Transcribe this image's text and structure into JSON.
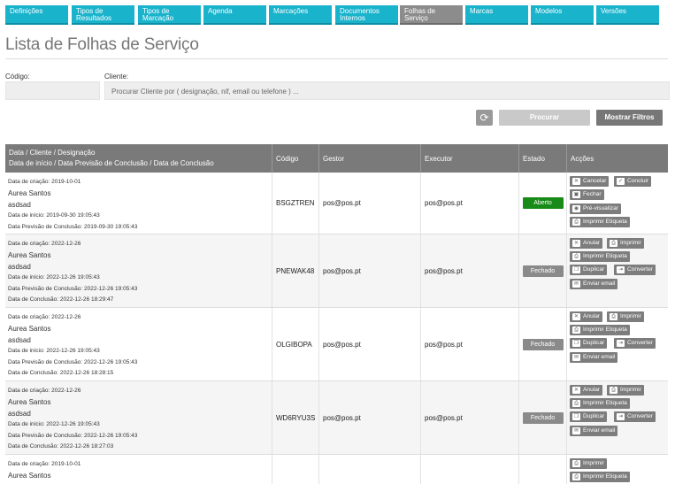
{
  "nav": {
    "tabs": [
      {
        "label": "Definições",
        "active": false
      },
      {
        "label": "Tipos de Resultados",
        "active": false
      },
      {
        "label": "Tipos de Marcação",
        "active": false
      },
      {
        "label": "Agenda",
        "active": false
      },
      {
        "label": "Marcações",
        "active": false
      },
      {
        "label": "Documentos Internos",
        "active": false
      },
      {
        "label": "Folhas de Serviço",
        "active": true
      },
      {
        "label": "Marcas",
        "active": false
      },
      {
        "label": "Modelos",
        "active": false
      },
      {
        "label": "Versões",
        "active": false
      }
    ]
  },
  "page_title": "Lista de Folhas de Serviço",
  "filters": {
    "codigo_label": "Código:",
    "codigo_value": "",
    "cliente_label": "Cliente:",
    "cliente_placeholder": "Procurar Cliente por ( designação, nif, email ou telefone ) ..."
  },
  "buttons": {
    "procurar": "Procurar",
    "mostrar_filtros": "Mostrar Filtros",
    "refresh_icon": "refresh-icon"
  },
  "table": {
    "headers": {
      "main_line1": "Data / Cliente / Designação",
      "main_line2": "Data de início / Data Previsão de Conclusão / Data de Conclusão",
      "codigo": "Código",
      "gestor": "Gestor",
      "executor": "Executor",
      "estado": "Estado",
      "accoes": "Acções"
    },
    "rows": [
      {
        "criacao": "Data de criação: 2019-10-01",
        "cliente": "Aurea Santos",
        "designacao": "asdsad",
        "inicio": "Data de início: 2019-09-30 19:05:43",
        "previsao": "Data Previsão de Conclusão: 2019-09-30 19:05:43",
        "conclusao": "",
        "codigo": "BSGZTREN",
        "gestor": "pos@pos.pt",
        "executor": "pos@pos.pt",
        "estado": "Aberto",
        "estado_color": "#188a17",
        "actions": [
          "Cancelar",
          "Concluir",
          "Fechar",
          "Pré-visualizar",
          "Imprimir Etiqueta"
        ]
      },
      {
        "criacao": "Data de criação: 2022-12-26",
        "cliente": "Aurea Santos",
        "designacao": "asdsad",
        "inicio": "Data de início: 2022-12-26 19:05:43",
        "previsao": "Data Previsão de Conclusão: 2022-12-26 19:05:43",
        "conclusao": "Data de Conclusão: 2022-12-26 18:29:47",
        "codigo": "PNEWAK48",
        "gestor": "pos@pos.pt",
        "executor": "pos@pos.pt",
        "estado": "Fechado",
        "estado_color": "#8a8a8a",
        "actions": [
          "Anular",
          "Imprimir",
          "Imprimir Etiqueta",
          "Duplicar",
          "Converter",
          "Enviar email"
        ]
      },
      {
        "criacao": "Data de criação: 2022-12-26",
        "cliente": "Aurea Santos",
        "designacao": "asdsad",
        "inicio": "Data de início: 2022-12-26 19:05:43",
        "previsao": "Data Previsão de Conclusão: 2022-12-26 19:05:43",
        "conclusao": "Data de Conclusão: 2022-12-26 18:28:15",
        "codigo": "OLGIBOPA",
        "gestor": "pos@pos.pt",
        "executor": "pos@pos.pt",
        "estado": "Fechado",
        "estado_color": "#8a8a8a",
        "actions": [
          "Anular",
          "Imprimir",
          "Imprimir Etiqueta",
          "Duplicar",
          "Converter",
          "Enviar email"
        ]
      },
      {
        "criacao": "Data de criação: 2022-12-26",
        "cliente": "Aurea Santos",
        "designacao": "asdsad",
        "inicio": "Data de início: 2022-12-26 19:05:43",
        "previsao": "Data Previsão de Conclusão: 2022-12-26 19:05:43",
        "conclusao": "Data de Conclusão: 2022-12-26 18:27:03",
        "codigo": "WD6RYU3S",
        "gestor": "pos@pos.pt",
        "executor": "pos@pos.pt",
        "estado": "Fechado",
        "estado_color": "#8a8a8a",
        "actions": [
          "Anular",
          "Imprimir",
          "Imprimir Etiqueta",
          "Duplicar",
          "Converter",
          "Enviar email"
        ]
      },
      {
        "criacao": "Data de criação: 2019-10-01",
        "cliente": "Aurea Santos",
        "designacao": "",
        "inicio": "",
        "previsao": "",
        "conclusao": "",
        "codigo": "",
        "gestor": "",
        "executor": "",
        "estado": "",
        "estado_color": "",
        "actions": [
          "Imprimir",
          "Imprimir Etiqueta"
        ]
      }
    ]
  }
}
